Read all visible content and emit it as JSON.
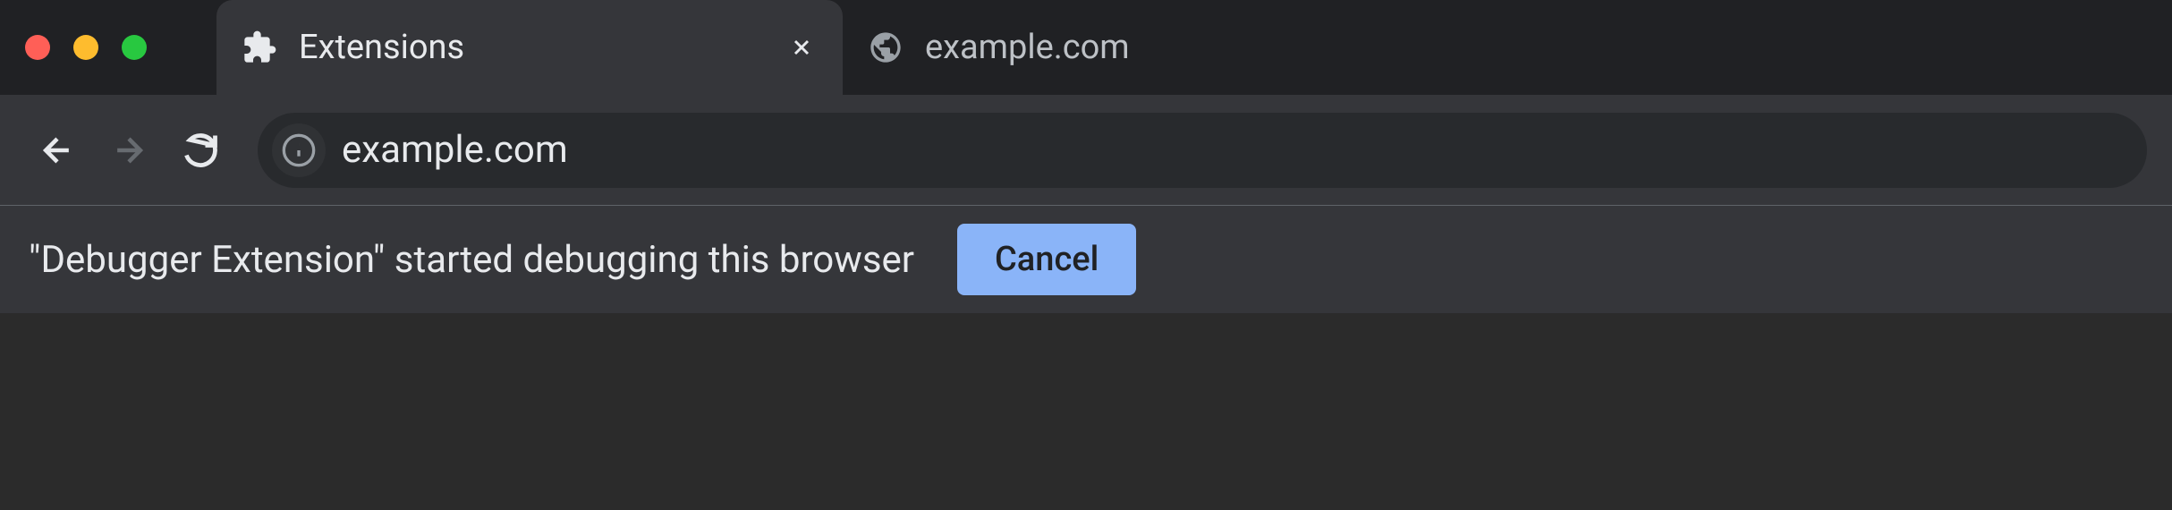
{
  "tabs": [
    {
      "title": "Extensions",
      "icon": "puzzle-piece-icon",
      "active": true
    },
    {
      "title": "example.com",
      "icon": "globe-icon",
      "active": false
    }
  ],
  "omnibox": {
    "url": "example.com"
  },
  "infobar": {
    "message": "\"Debugger Extension\" started debugging this browser",
    "button_label": "Cancel"
  }
}
